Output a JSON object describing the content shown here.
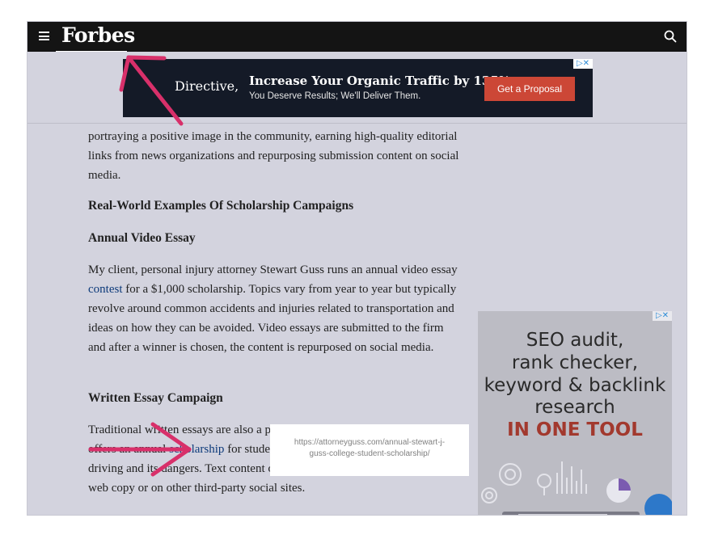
{
  "header": {
    "logo": "Forbes",
    "menu_icon": "hamburger-menu-icon",
    "search_icon": "search-icon"
  },
  "top_ad": {
    "brand": "Directive,",
    "headline": "Increase Your Organic Traffic by 135%",
    "subline": "You Deserve Results; We'll Deliver Them.",
    "cta": "Get a Proposal",
    "adchoice": "▷✕"
  },
  "article": {
    "p1": "portraying a positive image in the community, earning high-quality editorial links from news organizations and repurposing submission content on social media.",
    "h_examples": "Real-World Examples Of Scholarship Campaigns",
    "h_video": "Annual Video Essay",
    "p2_before": "My client, personal injury attorney Stewart Guss runs an annual video essay ",
    "p2_link": "contest",
    "p2_after": " for a $1,000 scholarship. Topics vary from year to year but typically revolve around common accidents and injuries related to transportation and ideas on how they can be avoided. Video essays are submitted to the firm and after a winner is chosen, the content is repurposed on social media.",
    "h_written": "Written Essay Campaign",
    "p3_before": "Traditional written essays are also a popular option. Our client, Page Law, offers an annual ",
    "p3_link": "scholarship",
    "p3_after": " for students who write an essay on aggressive driving and its dangers. Text content can also be repurposed in blog posts, as web copy or on other third-party social sites."
  },
  "tooltip": {
    "url": "https://attorneyguss.com/annual-stewart-j-guss-college-student-scholarship/"
  },
  "side_ad": {
    "lines": [
      "SEO audit,",
      "rank checker,",
      "keyword & backlink",
      "research"
    ],
    "highlight": "IN ONE TOOL",
    "adchoice": "▷✕"
  },
  "colors": {
    "topbar": "#141414",
    "page_bg": "#d3d3de",
    "annotation_arrow": "#d8306a",
    "cta": "#cc4736",
    "link": "#0d3a7a"
  }
}
